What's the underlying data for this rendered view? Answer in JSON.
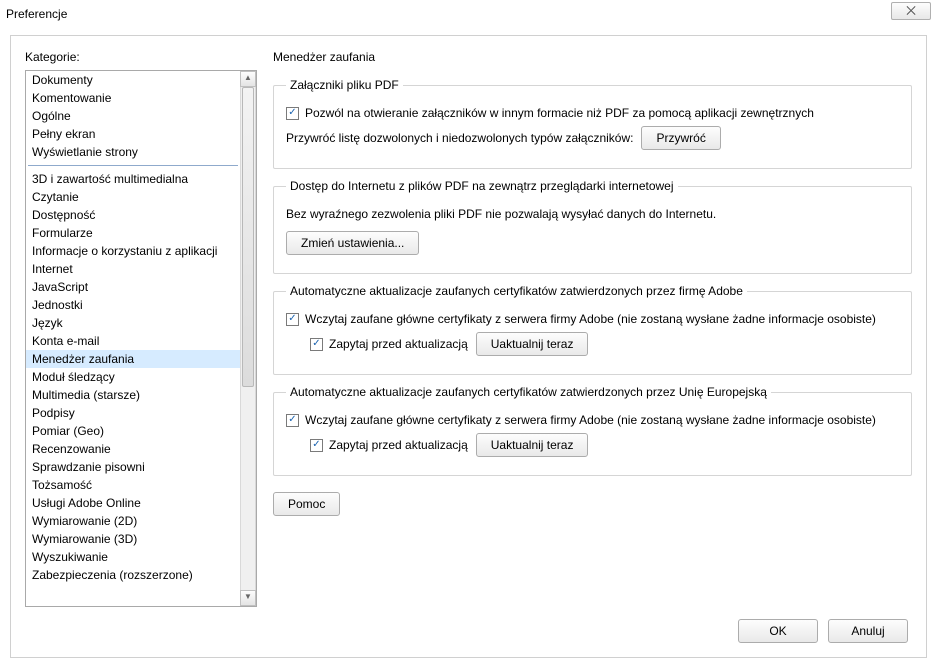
{
  "window": {
    "title": "Preferencje",
    "close_glyph": "⨉"
  },
  "sidebar": {
    "label": "Kategorie:",
    "group1": [
      "Dokumenty",
      "Komentowanie",
      "Ogólne",
      "Pełny ekran",
      "Wyświetlanie strony"
    ],
    "group2": [
      "3D i zawartość multimedialna",
      "Czytanie",
      "Dostępność",
      "Formularze",
      "Informacje o korzystaniu z aplikacji",
      "Internet",
      "JavaScript",
      "Jednostki",
      "Język",
      "Konta e-mail",
      "Menedżer zaufania",
      "Moduł śledzący",
      "Multimedia (starsze)",
      "Podpisy",
      "Pomiar (Geo)",
      "Recenzowanie",
      "Sprawdzanie pisowni",
      "Tożsamość",
      "Usługi Adobe Online",
      "Wymiarowanie (2D)",
      "Wymiarowanie (3D)",
      "Wyszukiwanie",
      "Zabezpieczenia (rozszerzone)"
    ],
    "selected": "Menedżer zaufania"
  },
  "page": {
    "title": "Menedżer zaufania",
    "attachments": {
      "legend": "Załączniki pliku PDF",
      "allow_label": "Pozwól na otwieranie załączników w innym formacie niż PDF za pomocą aplikacji zewnętrznych",
      "allow_checked": true,
      "restore_text": "Przywróć listę dozwolonych i niedozwolonych typów załączników:",
      "restore_button": "Przywróć"
    },
    "internet": {
      "legend": "Dostęp do Internetu z plików PDF na zewnątrz przeglądarki internetowej",
      "info": "Bez wyraźnego zezwolenia pliki PDF nie pozwalają wysyłać danych do Internetu.",
      "change_button": "Zmień ustawienia..."
    },
    "adobe_updates": {
      "legend": "Automatyczne aktualizacje zaufanych certyfikatów zatwierdzonych przez firmę Adobe",
      "load_label": "Wczytaj zaufane główne certyfikaty z serwera firmy Adobe (nie zostaną wysłane żadne informacje osobiste)",
      "load_checked": true,
      "ask_label": "Zapytaj przed aktualizacją",
      "ask_checked": true,
      "update_button": "Uaktualnij teraz"
    },
    "eu_updates": {
      "legend": "Automatyczne aktualizacje zaufanych certyfikatów zatwierdzonych przez Unię Europejską",
      "load_label": "Wczytaj zaufane główne certyfikaty z serwera firmy Adobe (nie zostaną wysłane żadne informacje osobiste)",
      "load_checked": true,
      "ask_label": "Zapytaj przed aktualizacją",
      "ask_checked": true,
      "update_button": "Uaktualnij teraz"
    },
    "help_button": "Pomoc"
  },
  "buttons": {
    "ok": "OK",
    "cancel": "Anuluj"
  },
  "glyphs": {
    "check": "✓",
    "up": "▲",
    "down": "▼"
  }
}
